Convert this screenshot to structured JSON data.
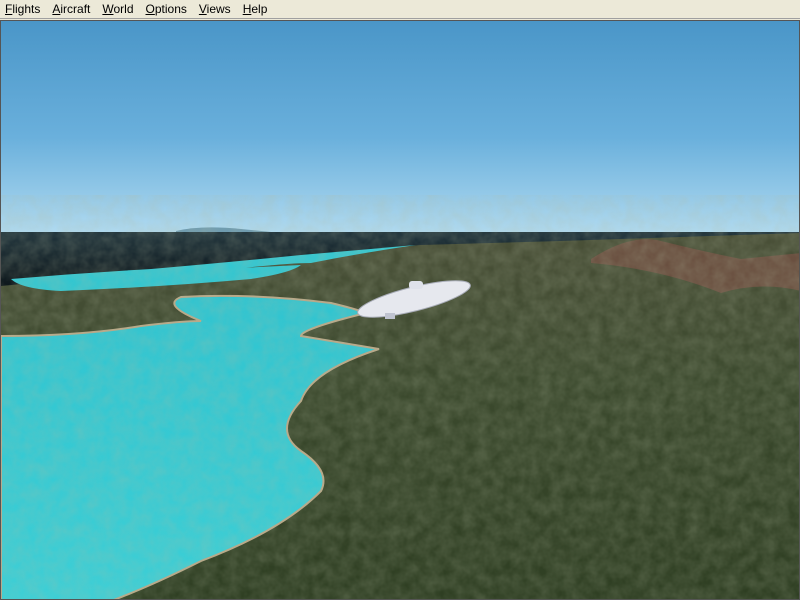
{
  "menu": [
    {
      "accel": "F",
      "rest": "lights"
    },
    {
      "accel": "A",
      "rest": "ircraft"
    },
    {
      "accel": "W",
      "rest": "orld"
    },
    {
      "accel": "O",
      "rest": "ptions"
    },
    {
      "accel": "V",
      "rest": "iews"
    },
    {
      "accel": "H",
      "rest": "elp"
    }
  ],
  "colors": {
    "sky_top": "#4a96c8",
    "sky_horizon": "#b0daf0",
    "ocean": "#14242c",
    "water": "#34c8d2",
    "land": "#3a4a2c"
  }
}
